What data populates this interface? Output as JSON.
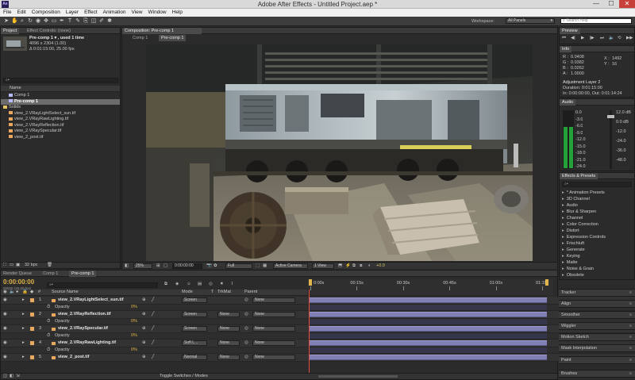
{
  "window": {
    "title": "Adobe After Effects - Untitled Project.aep *",
    "app_icon": "Ae",
    "minimize_label": "—",
    "maximize_label": "☐",
    "close_label": "✕"
  },
  "menu": [
    "File",
    "Edit",
    "Composition",
    "Layer",
    "Effect",
    "Animation",
    "View",
    "Window",
    "Help"
  ],
  "toolbar": {
    "workspace_label": "Workspace:",
    "workspace_value": "All Panels",
    "search_placeholder": "Search Help"
  },
  "project": {
    "tab_project": "Project",
    "tab_effect_controls": "Effect Controls: (none)",
    "item_name": "Pre-comp 1 ▾ , used 1 time",
    "item_size": "4096 x 2304 (1.00)",
    "item_duration": "Δ 0:01:15:00, 25.00 fps",
    "search_placeholder": "⌕▾",
    "col_name": "Name",
    "items": [
      {
        "label": "Comp 1",
        "type": "comp",
        "color": "#b9b9ff"
      },
      {
        "label": "Pre-comp 1",
        "type": "comp",
        "color": "#b9b9ff",
        "selected": true
      },
      {
        "label": "Solids",
        "type": "folder",
        "color": "#e4c463"
      },
      {
        "label": "view_2.VRayLightSelect_sun.tif",
        "type": "footage",
        "color": "#e8a860"
      },
      {
        "label": "view_2.VRayRawLighting.tif",
        "type": "footage",
        "color": "#e8a860"
      },
      {
        "label": "view_2.VRayReflection.tif",
        "type": "footage",
        "color": "#e8a860"
      },
      {
        "label": "view_2.VRaySpecular.tif",
        "type": "footage",
        "color": "#e8a860"
      },
      {
        "label": "view_2_post.tif",
        "type": "footage",
        "color": "#e8a860"
      }
    ],
    "bpc": "32 bpc"
  },
  "composition": {
    "tab_label": "Composition: Pre-comp 1",
    "sub_tab_inactive": "Comp 1",
    "sub_tab_active": "Pre-comp 1",
    "zoom": "25%",
    "timecode": "0:00:00:00",
    "resolution": "Full",
    "camera": "Active Camera",
    "view": "1 View",
    "exposure": "+0.0"
  },
  "preview": {
    "title": "Preview"
  },
  "info": {
    "title": "Info",
    "r_label": "R :",
    "r_value": "0.0408",
    "g_label": "G :",
    "g_value": "0.0382",
    "b_label": "B :",
    "b_value": "0.0262",
    "a_label": "A :",
    "a_value": "1.0000",
    "x_label": "X :",
    "x_value": "1492",
    "y_label": "Y :",
    "y_value": "16",
    "line1": "Adjustment Layer 2",
    "line2": "Duration: 0:01:15:00",
    "line3": "In: 0:00:00:00, Out: 0:01:14:24"
  },
  "audio": {
    "title": "Audio",
    "left_scale": [
      "0.0",
      "-3.0",
      "-6.0",
      "-9.0",
      "-12.0",
      "-15.0",
      "-18.0",
      "-21.0",
      "-24.0"
    ],
    "right_scale": [
      "12.0 dB",
      "0.0 dB",
      "-12.0",
      "-24.0",
      "-36.0",
      "-48.0"
    ],
    "level": 0.72
  },
  "effects": {
    "title": "Effects & Presets",
    "search_placeholder": "⌕▾",
    "items": [
      "* Animation Presets",
      "3D Channel",
      "Audio",
      "Blur & Sharpen",
      "Channel",
      "Color Correction",
      "Distort",
      "Expression Controls",
      "Frischluft",
      "Generate",
      "Keying",
      "Matte",
      "Noise & Grain",
      "Obsolete"
    ]
  },
  "right_panels": [
    "Tracker",
    "Align",
    "Smoother",
    "Wiggler",
    "Motion Sketch",
    "Mask Interpolation",
    "Paint",
    "Brushes"
  ],
  "timeline": {
    "tabs": [
      "Render Queue",
      "Comp 1",
      "Pre-comp 1"
    ],
    "timecode": "0:00:00:00",
    "timecode_sub": "00000 (25.00 fps)",
    "search_placeholder": "⌕▾",
    "col_source_name": "Source Name",
    "col_mode": "Mode",
    "col_t": "T",
    "col_trkmat": "TrkMat",
    "col_parent": "Parent",
    "ruler": [
      "0:00s",
      "00:15s",
      "00:30s",
      "00:45s",
      "01:00s",
      "01:15"
    ],
    "layers": [
      {
        "num": "1",
        "name": "view_2.VRayLightSelect_sun.tif",
        "mode": "Screen",
        "trkmat": "",
        "parent": "None",
        "opacity": "0%"
      },
      {
        "num": "2",
        "name": "view_2.VRayReflection.tif",
        "mode": "Screen",
        "trkmat": "None",
        "parent": "None",
        "opacity": "0%"
      },
      {
        "num": "3",
        "name": "view_2.VRaySpecular.tif",
        "mode": "Screen",
        "trkmat": "None",
        "parent": "None",
        "opacity": "0%"
      },
      {
        "num": "4",
        "name": "view_2.VRayRawLighting.tif",
        "mode": "Soft L...",
        "trkmat": "None",
        "parent": "None",
        "opacity": "0%"
      },
      {
        "num": "5",
        "name": "view_2_post.tif",
        "mode": "Normal",
        "trkmat": "None",
        "parent": "None",
        "opacity": ""
      }
    ],
    "opacity_label": "Opacity",
    "footer_label": "Toggle Switches / Modes"
  }
}
